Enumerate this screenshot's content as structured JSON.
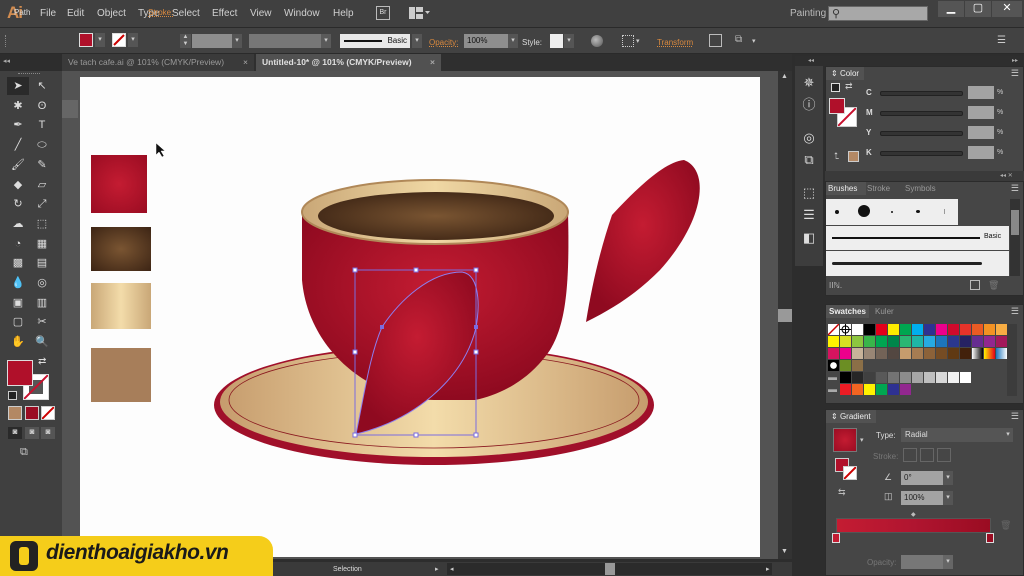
{
  "app": {
    "logo": "Ai",
    "workspace": "Painting",
    "workspace_arrow": "▾"
  },
  "menu": [
    "File",
    "Edit",
    "Object",
    "Type",
    "Select",
    "Effect",
    "View",
    "Window",
    "Help"
  ],
  "bridge_label": "Br",
  "window_controls": {
    "minimize": "▁",
    "maximize": "▢",
    "close": "✕"
  },
  "control_bar": {
    "selection_type": "Path",
    "fill_color": "#b0102a",
    "stroke_label": "Stroke:",
    "brush_label": "Basic",
    "opacity_label": "Opacity:",
    "opacity_value": "100%",
    "style_label": "Style:",
    "transform_label": "Transform"
  },
  "tabs": [
    {
      "label": "Ve tach cafe.ai @ 101% (CMYK/Preview)",
      "active": false
    },
    {
      "label": "Untitled-10* @ 101% (CMYK/Preview)",
      "active": true
    }
  ],
  "tab_close": "×",
  "tools": [
    "selection",
    "direct-selection",
    "magic-wand",
    "lasso",
    "pen",
    "type",
    "line",
    "ellipse",
    "paintbrush",
    "pencil",
    "blob-brush",
    "eraser",
    "rotate",
    "scale",
    "warp",
    "free-transform",
    "shape-builder",
    "perspective-grid",
    "mesh",
    "gradient",
    "eyedropper",
    "blend",
    "symbol-sprayer",
    "column-graph",
    "artboard",
    "slice",
    "hand",
    "zoom"
  ],
  "tool_glyphs": [
    "➤",
    "↖",
    "✱",
    "ʘ",
    "✒",
    "T",
    "╱",
    "⬭",
    "🖌",
    "✎",
    "◆",
    "▱",
    "↻",
    "⤢",
    "☁",
    "⬚",
    "◔",
    "▦",
    "▩",
    "▤",
    "💧",
    "◎",
    "▣",
    "▥",
    "▢",
    "✂",
    "✋",
    "🔍"
  ],
  "toolbox": {
    "fill_color": "#b0102a",
    "swap_icon": "⇄",
    "mode_color": "#b38864"
  },
  "status": {
    "mode": "Selection"
  },
  "swatches_on_artboard": [
    {
      "name": "crimson-radial",
      "colors": [
        "#c41c32",
        "#9a0c22"
      ]
    },
    {
      "name": "coffee-brown-radial",
      "colors": [
        "#7a5532",
        "#3c2414"
      ]
    },
    {
      "name": "cream-linear",
      "colors": [
        "#c9a777",
        "#f3dcaa",
        "#c9a777"
      ]
    },
    {
      "name": "tan-solid",
      "colors": [
        "#a77e5a"
      ]
    }
  ],
  "color_panel": {
    "title": "Color",
    "channels": [
      {
        "label": "C",
        "unit": "%"
      },
      {
        "label": "M",
        "unit": "%"
      },
      {
        "label": "Y",
        "unit": "%"
      },
      {
        "label": "K",
        "unit": "%"
      }
    ],
    "fill": "#b0102a",
    "last_color": "#b38864"
  },
  "brushes_panel": {
    "tabs": [
      "Brushes",
      "Stroke",
      "Symbols"
    ],
    "basic_label": "Basic"
  },
  "swatches_panel": {
    "tabs": [
      "Swatches",
      "Kuler"
    ],
    "rows": [
      [
        "none",
        "reg",
        "#ffffff",
        "#000000",
        "#e3001b",
        "#ffec00",
        "#00a650",
        "#00aeef",
        "#2e3192",
        "#ec008c",
        "#cf0a2c",
        "#e6332a",
        "#ea5b24",
        "#f39223",
        "#f8ad43"
      ],
      [
        "#fff200",
        "#d7df23",
        "#8dc63f",
        "#39b54a",
        "#00a651",
        "#00854a",
        "#2bb673",
        "#1eb5a6",
        "#27aae1",
        "#1c75bc",
        "#2b388f",
        "#262262",
        "#662d91",
        "#92278f",
        "#a3195b"
      ],
      [
        "#d6145f",
        "#ec008c",
        "#c7b299",
        "#998675",
        "#736357",
        "#534741",
        "#c69c6d",
        "#a67c52",
        "#8c6239",
        "#754c24",
        "#603913",
        "#42210b",
        "grad-bw",
        "grad-yellow",
        "grad-blue"
      ],
      [
        "pattern1",
        "pattern2",
        "pattern3"
      ],
      [
        "folder",
        "#000000",
        "#262626",
        "#404040",
        "#595959",
        "#737373",
        "#8c8c8c",
        "#a6a6a6",
        "#bfbfbf",
        "#d9d9d9",
        "#f2f2f2",
        "#ffffff"
      ],
      [
        "folder",
        "#ed1c24",
        "#f26522",
        "#fff200",
        "#00a651",
        "#2e3192",
        "#92278f"
      ]
    ]
  },
  "gradient_panel": {
    "title": "Gradient",
    "type_label": "Type:",
    "type_value": "Radial",
    "stroke_label": "Stroke:",
    "angle_value": "0°",
    "aspect_value": "100%",
    "opacity_label": "Opacity:",
    "stops": [
      "#c41c32",
      "#9a0c22"
    ]
  },
  "watermark": {
    "text": "dienthoaigiakho.vn",
    "color": "#f5cd1a"
  }
}
